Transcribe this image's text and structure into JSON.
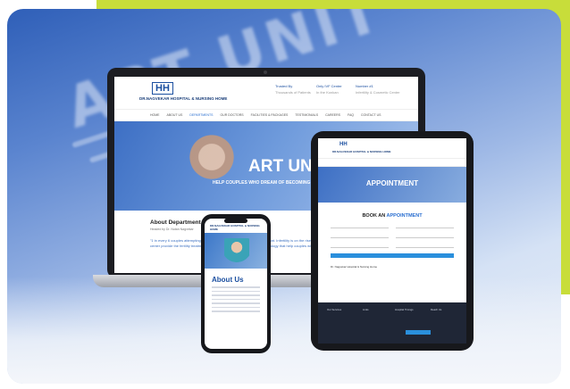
{
  "laptop": {
    "logo_mark": "HH",
    "logo_name": "DR.NAGVEKAR HOSPITAL & NURSING HOME",
    "header_info": [
      {
        "title": "Trusted By",
        "sub": "Thousands of Patients"
      },
      {
        "title": "Only IVF Center",
        "sub": "In the Konkan"
      },
      {
        "title": "Number #1",
        "sub": "Infertility & Cosmetic Center"
      }
    ],
    "nav": [
      "HOME",
      "ABOUT US",
      "DEPARTMENTS",
      "OUR DOCTORS",
      "FACILITIES & PACKAGES",
      "TESTIMONIALS",
      "CAREERS",
      "FAQ",
      "CONTACT US"
    ],
    "hero_title": "ART UNIT",
    "hero_subtitle": "HELP COUPLES WHO DREAM OF BECOMING PARENTS",
    "about_heading": "About Department",
    "about_meta": "Headed by Dr. Nutan Nagvekar",
    "about_quote": "\"1 in every 6 couples attempting to conceive struggles with becoming pregnant. Infertility is on the rise due to various reasons. We, at our IVF center provide the fertility treatment, clinical excellence, and the latest technology that help couples with their dream of becoming parents.\""
  },
  "tablet": {
    "logo_mark": "HH",
    "logo_name": "DR.NAGVEKAR HOSPITAL & NURSING HOME",
    "hero_title": "APPOINTMENT",
    "book_prefix": "BOOK AN ",
    "book_highlight": "APPOINTMENT",
    "meta_title": "Dr. Nagvekar Hospital & Nursing Home",
    "footer_cols": [
      "Our Services",
      "Links",
      "Hospital Timings",
      "Reach Us"
    ]
  },
  "phone": {
    "logo_name": "DR.NAGVEKAR HOSPITAL & NURSING HOME",
    "about_title": "About Us"
  },
  "background": {
    "blur_text": "ART UNIT"
  }
}
